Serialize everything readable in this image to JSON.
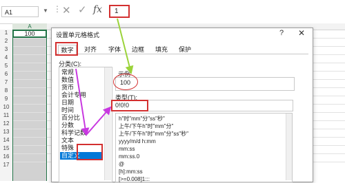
{
  "formula_bar": {
    "name_box": "A1",
    "name_caret": "▼",
    "separator": "⋮",
    "cancel_glyph": "✕",
    "confirm_glyph": "✓",
    "fx_label": "fx",
    "value": "1"
  },
  "sheet": {
    "column_a": "A",
    "rows": [
      "1",
      "2",
      "3",
      "4",
      "5",
      "6",
      "7",
      "8",
      "9",
      "10",
      "11",
      "12",
      "13",
      "14",
      "15",
      "16",
      "17"
    ],
    "cell_a1": "100"
  },
  "dialog": {
    "title": "设置单元格格式",
    "help": "?",
    "close": "✕",
    "tabs": [
      "数字",
      "对齐",
      "字体",
      "边框",
      "填充",
      "保护"
    ],
    "category_label": "分类(C):",
    "categories": [
      "常规",
      "数值",
      "货币",
      "会计专用",
      "日期",
      "时间",
      "百分比",
      "分数",
      "科学记数",
      "文本",
      "特殊",
      "自定义"
    ],
    "selected_category": "自定义",
    "sample_label": "示例",
    "sample_value": "100",
    "type_label": "类型(T):",
    "type_value": "0!0!0",
    "formats": [
      "h\"时\"mm\"分\"ss\"秒\"",
      "上午/下午h\"时\"mm\"分\"",
      "上午/下午h\"时\"mm\"分\"ss\"秒\"",
      "yyyy/m/d h:mm",
      "mm:ss",
      "mm:ss.0",
      "@",
      "[h]:mm:ss",
      "[>=0.008]1:::"
    ]
  },
  "colors": {
    "highlight_red": "#d32f2f",
    "arrow_green": "#9bd33a",
    "arrow_magenta": "#c838e0",
    "selection_blue": "#0078d7",
    "excel_green": "#217346"
  }
}
